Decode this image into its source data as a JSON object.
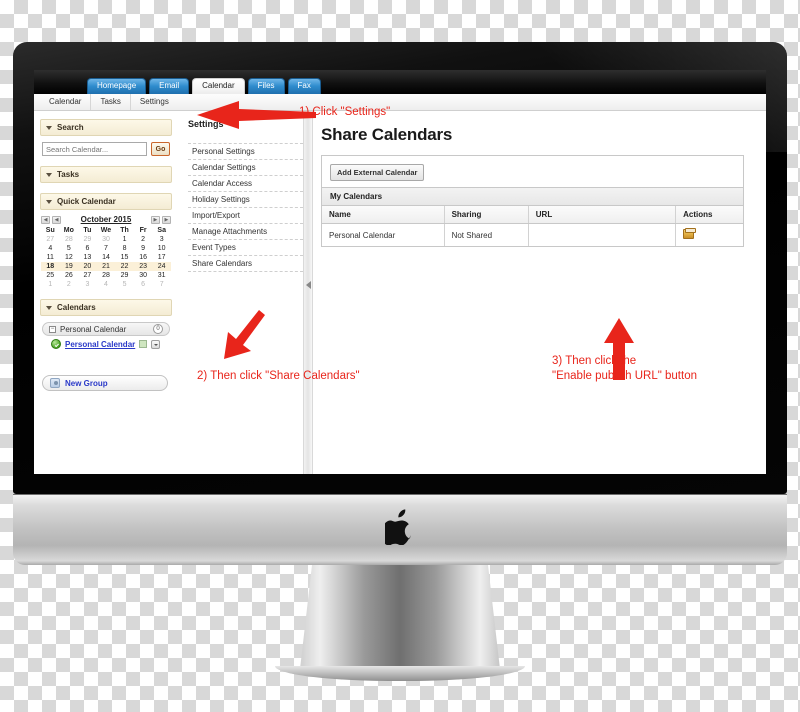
{
  "device": {
    "brand_logo": "apple-logo"
  },
  "app": {
    "tabs": [
      {
        "label": "Homepage",
        "active": false
      },
      {
        "label": "Email",
        "active": false
      },
      {
        "label": "Calendar",
        "active": true
      },
      {
        "label": "Files",
        "active": false
      },
      {
        "label": "Fax",
        "active": false
      }
    ],
    "subnav": [
      "Calendar",
      "Tasks",
      "Settings"
    ]
  },
  "sidebar": {
    "search": {
      "title": "Search",
      "placeholder": "Search Calendar...",
      "value": "",
      "go_label": "Go"
    },
    "tasks": {
      "title": "Tasks"
    },
    "quick_calendar": {
      "title": "Quick Calendar",
      "month_label": "October 2015",
      "weekdays": [
        "Su",
        "Mo",
        "Tu",
        "We",
        "Th",
        "Fr",
        "Sa"
      ],
      "weeks": [
        [
          {
            "d": "27",
            "mute": true
          },
          {
            "d": "28",
            "mute": true
          },
          {
            "d": "29",
            "mute": true
          },
          {
            "d": "30",
            "mute": true
          },
          {
            "d": "1"
          },
          {
            "d": "2"
          },
          {
            "d": "3"
          }
        ],
        [
          {
            "d": "4"
          },
          {
            "d": "5"
          },
          {
            "d": "6"
          },
          {
            "d": "7"
          },
          {
            "d": "8"
          },
          {
            "d": "9"
          },
          {
            "d": "10"
          }
        ],
        [
          {
            "d": "11"
          },
          {
            "d": "12"
          },
          {
            "d": "13"
          },
          {
            "d": "14"
          },
          {
            "d": "15"
          },
          {
            "d": "16"
          },
          {
            "d": "17"
          }
        ],
        [
          {
            "d": "18",
            "today": true
          },
          {
            "d": "19"
          },
          {
            "d": "20"
          },
          {
            "d": "21"
          },
          {
            "d": "22"
          },
          {
            "d": "23"
          },
          {
            "d": "24"
          }
        ],
        [
          {
            "d": "25"
          },
          {
            "d": "26"
          },
          {
            "d": "27"
          },
          {
            "d": "28"
          },
          {
            "d": "29"
          },
          {
            "d": "30"
          },
          {
            "d": "31"
          }
        ],
        [
          {
            "d": "1",
            "mute": true
          },
          {
            "d": "2",
            "mute": true
          },
          {
            "d": "3",
            "mute": true
          },
          {
            "d": "4",
            "mute": true
          },
          {
            "d": "5",
            "mute": true
          },
          {
            "d": "6",
            "mute": true
          },
          {
            "d": "7",
            "mute": true
          }
        ]
      ],
      "current_week_index": 3,
      "nav": {
        "first": "◀◀",
        "prev": "◀",
        "next": "▶",
        "last": "▶▶"
      }
    },
    "calendars": {
      "title": "Calendars",
      "group_label": "Personal Calendar",
      "group_count": "0",
      "entry_label": "Personal Calendar",
      "new_group_label": "New Group"
    }
  },
  "settings_panel": {
    "title": "Settings",
    "items": [
      "Personal Settings",
      "Calendar Settings",
      "Calendar Access",
      "Holiday Settings",
      "Import/Export",
      "Manage Attachments",
      "Event Types",
      "Share Calendars"
    ]
  },
  "main": {
    "page_title": "Share Calendars",
    "add_external_label": "Add External Calendar",
    "section_label": "My Calendars",
    "columns": [
      "Name",
      "Sharing",
      "URL",
      "Actions"
    ],
    "rows": [
      {
        "name": "Personal Calendar",
        "sharing": "Not Shared",
        "url": "",
        "action_icon": "enable-publish-url-icon"
      }
    ]
  },
  "annotations": {
    "accent_color": "#e8251b",
    "step1": "1) Click \"Settings\"",
    "step2": "2) Then click \"Share Calendars\"",
    "step3_line1": "3) Then click the",
    "step3_line2": "\"Enable publish URL\" button"
  }
}
